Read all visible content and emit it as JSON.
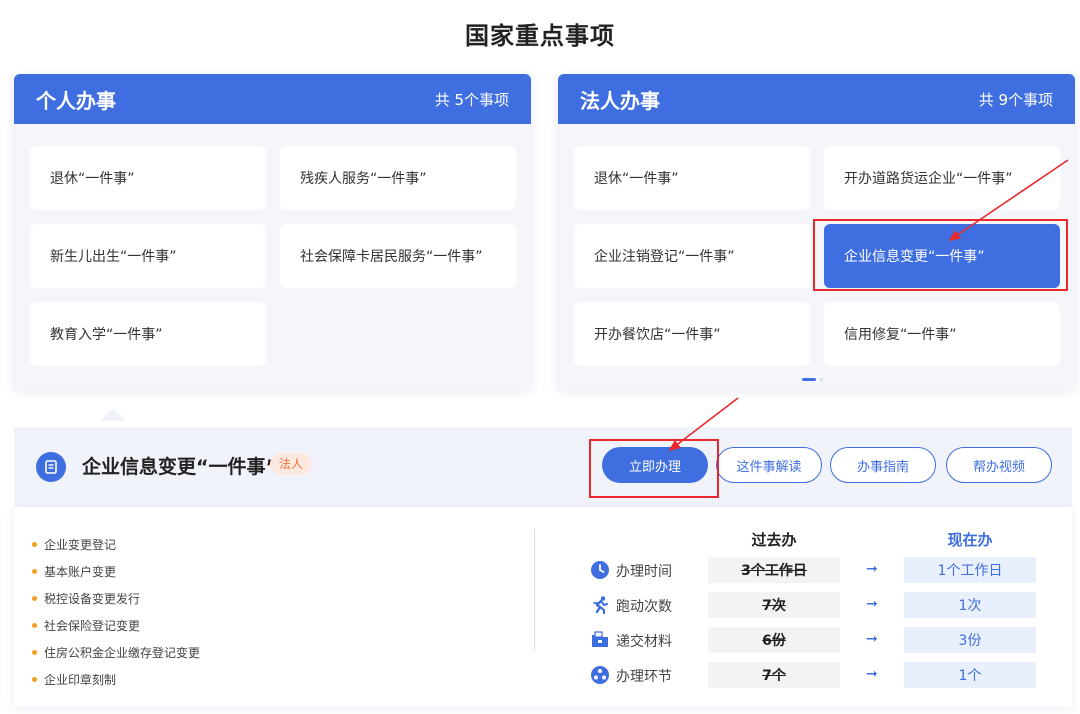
{
  "page_title": "国家重点事项",
  "personal": {
    "title": "个人办事",
    "count": "共 5个事项",
    "items": [
      "退休“一件事”",
      "残疾人服务“一件事”",
      "新生儿出生“一件事”",
      "社会保障卡居民服务“一件事”",
      "教育入学“一件事”"
    ]
  },
  "legal": {
    "title": "法人办事",
    "count": "共 9个事项",
    "items": [
      "退休“一件事”",
      "开办道路货运企业“一件事”",
      "企业注销登记“一件事”",
      "企业信息变更“一件事”",
      "开办餐饮店“一件事”",
      "信用修复“一件事”"
    ],
    "active_index": 3
  },
  "detail": {
    "title": "企业信息变更“一件事”",
    "tag": "法人",
    "buttons": {
      "apply": "立即办理",
      "explain": "这件事解读",
      "guide": "办事指南",
      "video": "帮办视频"
    },
    "sub_items": [
      "企业变更登记",
      "基本账户变更",
      "税控设备变更发行",
      "社会保险登记变更",
      "住房公积金企业缴存登记变更",
      "企业印章刻制"
    ]
  },
  "comparison": {
    "past_label": "过去办",
    "now_label": "现在办",
    "arrow": "➞",
    "rows": [
      {
        "icon": "clock-icon",
        "label": "办理时间",
        "past": "3个工作日",
        "now": "1个工作日"
      },
      {
        "icon": "running-icon",
        "label": "跑动次数",
        "past": "7次",
        "now": "1次"
      },
      {
        "icon": "folder-icon",
        "label": "递交材料",
        "past": "6份",
        "now": "3份"
      },
      {
        "icon": "process-icon",
        "label": "办理环节",
        "past": "7个",
        "now": "1个"
      }
    ]
  },
  "colors": {
    "primary": "#3f6ee0",
    "highlight": "#e8282b",
    "tag": "#f0743a",
    "bullet": "#f0a020"
  }
}
